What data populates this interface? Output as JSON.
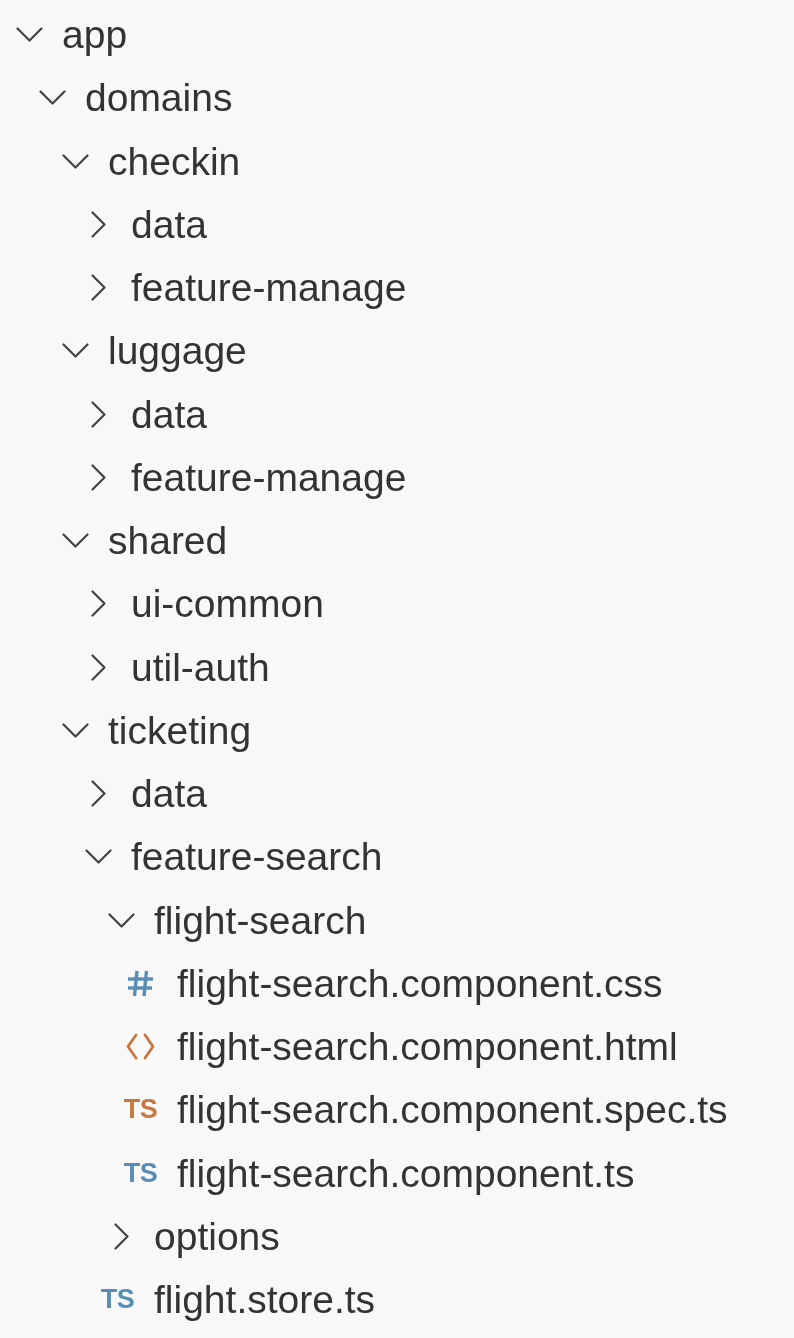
{
  "tree": [
    {
      "name": "app",
      "kind": "folder",
      "expanded": true,
      "children": [
        {
          "name": "domains",
          "kind": "folder",
          "expanded": true,
          "children": [
            {
              "name": "checkin",
              "kind": "folder",
              "expanded": true,
              "children": [
                {
                  "name": "data",
                  "kind": "folder",
                  "expanded": false
                },
                {
                  "name": "feature-manage",
                  "kind": "folder",
                  "expanded": false
                }
              ]
            },
            {
              "name": "luggage",
              "kind": "folder",
              "expanded": true,
              "children": [
                {
                  "name": "data",
                  "kind": "folder",
                  "expanded": false
                },
                {
                  "name": "feature-manage",
                  "kind": "folder",
                  "expanded": false
                }
              ]
            },
            {
              "name": "shared",
              "kind": "folder",
              "expanded": true,
              "children": [
                {
                  "name": "ui-common",
                  "kind": "folder",
                  "expanded": false
                },
                {
                  "name": "util-auth",
                  "kind": "folder",
                  "expanded": false
                }
              ]
            },
            {
              "name": "ticketing",
              "kind": "folder",
              "expanded": true,
              "children": [
                {
                  "name": "data",
                  "kind": "folder",
                  "expanded": false
                },
                {
                  "name": "feature-search",
                  "kind": "folder",
                  "expanded": true,
                  "children": [
                    {
                      "name": "flight-search",
                      "kind": "folder",
                      "expanded": true,
                      "children": [
                        {
                          "name": "flight-search.component.css",
                          "kind": "css",
                          "color": "#5a8db3"
                        },
                        {
                          "name": "flight-search.component.html",
                          "kind": "html",
                          "color": "#c8783f"
                        },
                        {
                          "name": "flight-search.component.spec.ts",
                          "kind": "ts",
                          "badge": "TS",
                          "color": "#c8783f"
                        },
                        {
                          "name": "flight-search.component.ts",
                          "kind": "ts",
                          "badge": "TS",
                          "color": "#5a8db3"
                        }
                      ]
                    },
                    {
                      "name": "options",
                      "kind": "folder",
                      "expanded": false
                    },
                    {
                      "name": "flight.store.ts",
                      "kind": "ts",
                      "badge": "TS",
                      "color": "#5a8db3"
                    }
                  ]
                }
              ]
            }
          ]
        }
      ]
    }
  ]
}
